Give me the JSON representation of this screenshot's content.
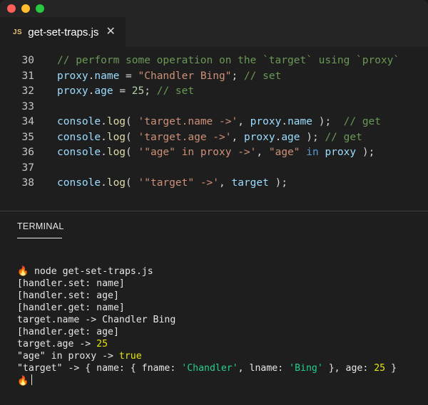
{
  "tab": {
    "icon_label": "JS",
    "filename": "get-set-traps.js"
  },
  "editor": {
    "lines": [
      {
        "n": "30",
        "t": [
          {
            "c": "comment",
            "s": "// perform some operation on the `target` using `proxy`"
          }
        ]
      },
      {
        "n": "31",
        "t": [
          {
            "c": "var",
            "s": "proxy"
          },
          {
            "c": "plain",
            "s": "."
          },
          {
            "c": "var",
            "s": "name"
          },
          {
            "c": "plain",
            "s": " = "
          },
          {
            "c": "string",
            "s": "\"Chandler Bing\""
          },
          {
            "c": "plain",
            "s": "; "
          },
          {
            "c": "comment",
            "s": "// set"
          }
        ]
      },
      {
        "n": "32",
        "t": [
          {
            "c": "var",
            "s": "proxy"
          },
          {
            "c": "plain",
            "s": "."
          },
          {
            "c": "var",
            "s": "age"
          },
          {
            "c": "plain",
            "s": " = "
          },
          {
            "c": "number",
            "s": "25"
          },
          {
            "c": "plain",
            "s": "; "
          },
          {
            "c": "comment",
            "s": "// set"
          }
        ]
      },
      {
        "n": "33",
        "t": []
      },
      {
        "n": "34",
        "t": [
          {
            "c": "var",
            "s": "console"
          },
          {
            "c": "plain",
            "s": "."
          },
          {
            "c": "func",
            "s": "log"
          },
          {
            "c": "plain",
            "s": "( "
          },
          {
            "c": "string",
            "s": "'target.name ->'"
          },
          {
            "c": "plain",
            "s": ", "
          },
          {
            "c": "var",
            "s": "proxy"
          },
          {
            "c": "plain",
            "s": "."
          },
          {
            "c": "var",
            "s": "name"
          },
          {
            "c": "plain",
            "s": " );  "
          },
          {
            "c": "comment",
            "s": "// get"
          }
        ]
      },
      {
        "n": "35",
        "t": [
          {
            "c": "var",
            "s": "console"
          },
          {
            "c": "plain",
            "s": "."
          },
          {
            "c": "func",
            "s": "log"
          },
          {
            "c": "plain",
            "s": "( "
          },
          {
            "c": "string",
            "s": "'target.age ->'"
          },
          {
            "c": "plain",
            "s": ", "
          },
          {
            "c": "var",
            "s": "proxy"
          },
          {
            "c": "plain",
            "s": "."
          },
          {
            "c": "var",
            "s": "age"
          },
          {
            "c": "plain",
            "s": " ); "
          },
          {
            "c": "comment",
            "s": "// get"
          }
        ]
      },
      {
        "n": "36",
        "t": [
          {
            "c": "var",
            "s": "console"
          },
          {
            "c": "plain",
            "s": "."
          },
          {
            "c": "func",
            "s": "log"
          },
          {
            "c": "plain",
            "s": "( "
          },
          {
            "c": "string",
            "s": "'\"age\" in proxy ->'"
          },
          {
            "c": "plain",
            "s": ", "
          },
          {
            "c": "string",
            "s": "\"age\""
          },
          {
            "c": "plain",
            "s": " "
          },
          {
            "c": "keyword",
            "s": "in"
          },
          {
            "c": "plain",
            "s": " "
          },
          {
            "c": "var",
            "s": "proxy"
          },
          {
            "c": "plain",
            "s": " );"
          }
        ]
      },
      {
        "n": "37",
        "t": []
      },
      {
        "n": "38",
        "t": [
          {
            "c": "var",
            "s": "console"
          },
          {
            "c": "plain",
            "s": "."
          },
          {
            "c": "func",
            "s": "log"
          },
          {
            "c": "plain",
            "s": "( "
          },
          {
            "c": "string",
            "s": "'\"target\" ->'"
          },
          {
            "c": "plain",
            "s": ", "
          },
          {
            "c": "var",
            "s": "target"
          },
          {
            "c": "plain",
            "s": " );"
          }
        ]
      }
    ]
  },
  "terminal": {
    "tab_label": "TERMINAL",
    "prompt_icon": "🔥",
    "lines": [
      {
        "prompt": true,
        "t": [
          {
            "c": "",
            "s": " node get-set-traps.js"
          }
        ]
      },
      {
        "t": [
          {
            "c": "",
            "s": "[handler.set: name]"
          }
        ]
      },
      {
        "t": [
          {
            "c": "",
            "s": "[handler.set: age]"
          }
        ]
      },
      {
        "t": [
          {
            "c": "",
            "s": "[handler.get: name]"
          }
        ]
      },
      {
        "t": [
          {
            "c": "",
            "s": "target.name -> Chandler Bing"
          }
        ]
      },
      {
        "t": [
          {
            "c": "",
            "s": "[handler.get: age]"
          }
        ]
      },
      {
        "t": [
          {
            "c": "",
            "s": "target.age -> "
          },
          {
            "c": "yellow",
            "s": "25"
          }
        ]
      },
      {
        "t": [
          {
            "c": "",
            "s": "\"age\" in proxy -> "
          },
          {
            "c": "yellow",
            "s": "true"
          }
        ]
      },
      {
        "t": [
          {
            "c": "",
            "s": "\"target\" -> { name: { fname: "
          },
          {
            "c": "green",
            "s": "'Chandler'"
          },
          {
            "c": "",
            "s": ", lname: "
          },
          {
            "c": "green",
            "s": "'Bing'"
          },
          {
            "c": "",
            "s": " }, age: "
          },
          {
            "c": "yellow",
            "s": "25"
          },
          {
            "c": "",
            "s": " }"
          }
        ]
      },
      {
        "prompt": true,
        "cursor": true,
        "t": []
      }
    ]
  }
}
